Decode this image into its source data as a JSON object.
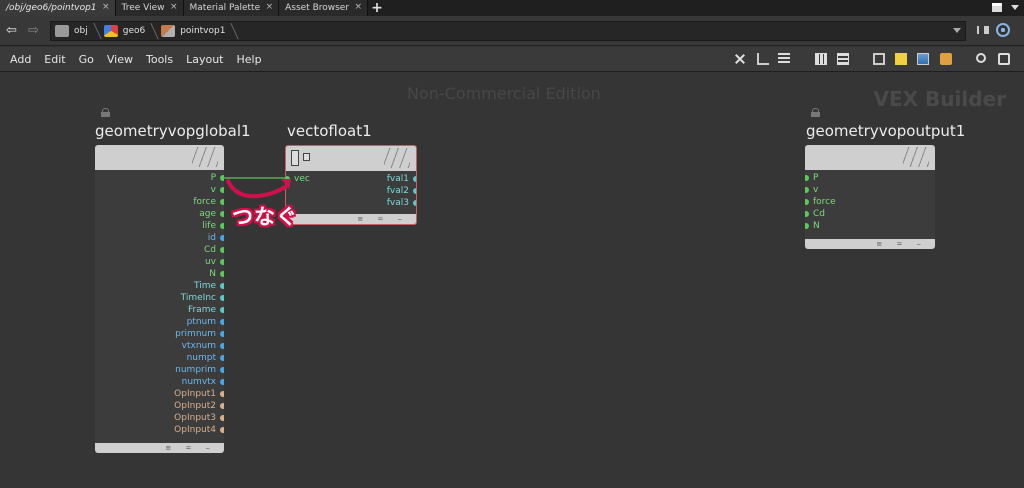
{
  "tabs": [
    {
      "label": "/obj/geo6/pointvop1",
      "active": true
    },
    {
      "label": "Tree View",
      "active": false
    },
    {
      "label": "Material Palette",
      "active": false
    },
    {
      "label": "Asset Browser",
      "active": false
    }
  ],
  "tab_close_glyph": "×",
  "tab_add_glyph": "+",
  "path": {
    "crumbs": [
      "obj",
      "geo6",
      "pointvop1"
    ]
  },
  "menu": [
    "Add",
    "Edit",
    "Go",
    "View",
    "Tools",
    "Layout",
    "Help"
  ],
  "canvas": {
    "watermark": "Non-Commercial Edition",
    "network_label": "VEX Builder"
  },
  "annotation": "つなぐ",
  "nodes": {
    "global": {
      "title": "geometryvopglobal1",
      "outputs": [
        {
          "name": "P",
          "color": "#5cc85c"
        },
        {
          "name": "v",
          "color": "#5cc85c"
        },
        {
          "name": "force",
          "color": "#5cc85c"
        },
        {
          "name": "age",
          "color": "#5cc85c"
        },
        {
          "name": "life",
          "color": "#5cc85c"
        },
        {
          "name": "id",
          "color": "#4aa8e8"
        },
        {
          "name": "Cd",
          "color": "#5cc85c"
        },
        {
          "name": "uv",
          "color": "#5cc85c"
        },
        {
          "name": "N",
          "color": "#5cc85c"
        },
        {
          "name": "Time",
          "color": "#5cc8c8"
        },
        {
          "name": "TimeInc",
          "color": "#5cc8c8"
        },
        {
          "name": "Frame",
          "color": "#5cc8c8"
        },
        {
          "name": "ptnum",
          "color": "#4aa8e8"
        },
        {
          "name": "primnum",
          "color": "#4aa8e8"
        },
        {
          "name": "vtxnum",
          "color": "#4aa8e8"
        },
        {
          "name": "numpt",
          "color": "#4aa8e8"
        },
        {
          "name": "numprim",
          "color": "#4aa8e8"
        },
        {
          "name": "numvtx",
          "color": "#4aa8e8"
        },
        {
          "name": "OpInput1",
          "color": "#d8b090"
        },
        {
          "name": "OpInput2",
          "color": "#d8b090"
        },
        {
          "name": "OpInput3",
          "color": "#d8b090"
        },
        {
          "name": "OpInput4",
          "color": "#d8b090"
        }
      ]
    },
    "vectofloat": {
      "title": "vectofloat1",
      "inputs": [
        {
          "name": "vec",
          "color": "#5cc85c"
        }
      ],
      "outputs": [
        {
          "name": "fval1",
          "color": "#5cc8c8"
        },
        {
          "name": "fval2",
          "color": "#5cc8c8"
        },
        {
          "name": "fval3",
          "color": "#5cc8c8"
        }
      ]
    },
    "output": {
      "title": "geometryvopoutput1",
      "inputs": [
        {
          "name": "P",
          "color": "#5cc85c"
        },
        {
          "name": "v",
          "color": "#5cc85c"
        },
        {
          "name": "force",
          "color": "#5cc85c"
        },
        {
          "name": "Cd",
          "color": "#5cc85c"
        },
        {
          "name": "N",
          "color": "#5cc85c"
        }
      ]
    }
  },
  "colors": {
    "wire": "#5cc85c",
    "annotation_arrow": "#d0104a",
    "label_green": "#7ed87e",
    "label_cyan": "#7ed8d8",
    "label_blue": "#6ab8f0",
    "label_tan": "#d8b090"
  },
  "icons": [
    "back-arrow-icon",
    "forward-arrow-icon",
    "obj-icon",
    "geo-icon",
    "vop-icon",
    "pin-icon",
    "target-icon",
    "tools-icon",
    "tree-icon",
    "list-icon",
    "grid-icon",
    "image-icon",
    "note-icon",
    "picture-icon",
    "box-icon",
    "search-icon",
    "eye-icon",
    "lock-icon"
  ]
}
